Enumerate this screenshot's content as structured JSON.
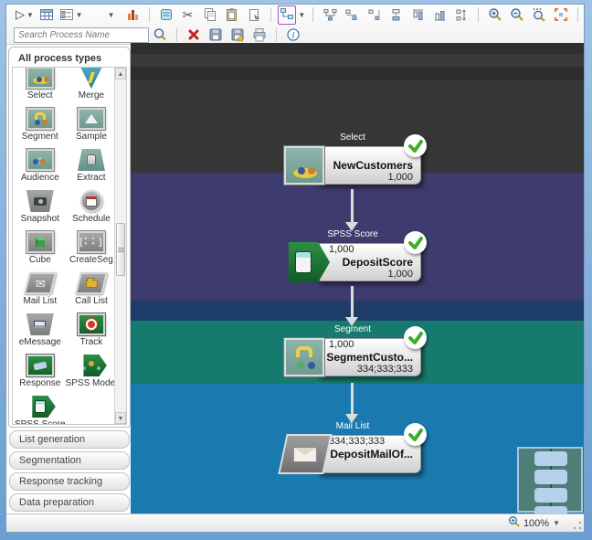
{
  "toolbar": {
    "search_placeholder": "Search Process Name",
    "row1_icons": [
      "run",
      "table",
      "properties-list",
      "dropdown",
      "reports-chart",
      "process-box",
      "cut",
      "copy",
      "paste",
      "add-note",
      "flowchart-view",
      "layout-hierarchy",
      "align-left",
      "align-right",
      "align-center",
      "align-top",
      "align-bottom",
      "distribute-vertical",
      "zoom-in",
      "zoom-out",
      "zoom-custom",
      "fit-to-view"
    ],
    "row2_icons": [
      "search",
      "delete",
      "save",
      "save-as",
      "print",
      "info"
    ]
  },
  "palette": {
    "header": "All process types",
    "items": [
      {
        "label": "Select",
        "icon": "select-icon"
      },
      {
        "label": "Merge",
        "icon": "merge-icon"
      },
      {
        "label": "Segment",
        "icon": "segment-icon"
      },
      {
        "label": "Sample",
        "icon": "sample-icon"
      },
      {
        "label": "Audience",
        "icon": "audience-icon"
      },
      {
        "label": "Extract",
        "icon": "extract-icon"
      },
      {
        "label": "Snapshot",
        "icon": "snapshot-icon"
      },
      {
        "label": "Schedule",
        "icon": "schedule-icon"
      },
      {
        "label": "Cube",
        "icon": "cube-icon"
      },
      {
        "label": "CreateSeg",
        "icon": "createseg-icon"
      },
      {
        "label": "Mail List",
        "icon": "mail-list-icon"
      },
      {
        "label": "Call List",
        "icon": "call-list-icon"
      },
      {
        "label": "eMessage",
        "icon": "emessage-icon"
      },
      {
        "label": "Track",
        "icon": "track-icon"
      },
      {
        "label": "Response",
        "icon": "response-icon"
      },
      {
        "label": "SPSS Model",
        "icon": "spss-model-icon"
      },
      {
        "label": "SPSS Score",
        "icon": "spss-score-icon"
      }
    ],
    "accordions": [
      "List generation",
      "Segmentation",
      "Response tracking",
      "Data preparation"
    ]
  },
  "canvas": {
    "band_colors": [
      "#2f2f2f",
      "#3a3a3a",
      "#2d2d2d",
      "#363636",
      "#3e3b6e",
      "#1e3c68",
      "#177a6e",
      "#1a79ae"
    ],
    "nodes": [
      {
        "type": "Select",
        "name": "NewCustomers",
        "input_count": "",
        "output_count": "1,000",
        "status": "success"
      },
      {
        "type": "SPSS Score",
        "name": "DepositScore",
        "input_count": "1,000",
        "output_count": "1,000",
        "status": "success"
      },
      {
        "type": "Segment",
        "name": "SegmentCusto...",
        "input_count": "1,000",
        "output_count": "334;333;333",
        "status": "success"
      },
      {
        "type": "Mail List",
        "name": "DepositMailOf...",
        "input_count": "334;333;333",
        "output_count": "",
        "status": "success"
      }
    ],
    "check_color": "#3fae2a"
  },
  "statusbar": {
    "zoom_level": "100%"
  }
}
